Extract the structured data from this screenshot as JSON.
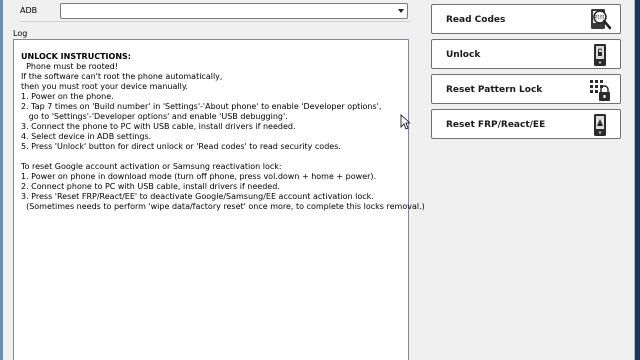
{
  "adb": {
    "label": "ADB",
    "selected": ""
  },
  "log": {
    "label": "Log",
    "title": "UNLOCK INSTRUCTIONS:",
    "lines": [
      "  Phone must be rooted!",
      "If the software can't root the phone automatically,",
      "then you must root your device manually.",
      "1. Power on the phone.",
      "2. Tap 7 times on 'Build number' in 'Settings'-'About phone' to enable 'Developer options',",
      "   go to 'Settings'-'Developer options' and enable 'USB debugging'.",
      "3. Connect the phone to PC with USB cable, install drivers if needed.",
      "4. Select device in ADB settings.",
      "5. Press 'Unlock' button for direct unlock or 'Read codes' to read security codes.",
      "",
      "To reset Google account activation or Samsung reactivation lock:",
      "1. Power on phone in download mode (turn off phone, press vol.down + home + power).",
      "2. Connect phone to PC with USB cable, install drivers if needed.",
      "3. Press 'Reset FRP/React/EE' to deactivate Google/Samsung/EE account activation lock.",
      "  (Sometimes needs to perform 'wipe data/factory reset' once more, to complete this locks removal.)"
    ]
  },
  "buttons": {
    "read_codes": "Read Codes",
    "unlock": "Unlock",
    "reset_pattern": "Reset Pattern Lock",
    "reset_frp": "Reset FRP/React/EE"
  },
  "icons": {
    "read_codes": "magnifier-phone-icon",
    "unlock": "phone-unlock-icon",
    "reset_pattern": "keypad-lock-icon",
    "reset_frp": "phone-reset-icon"
  }
}
